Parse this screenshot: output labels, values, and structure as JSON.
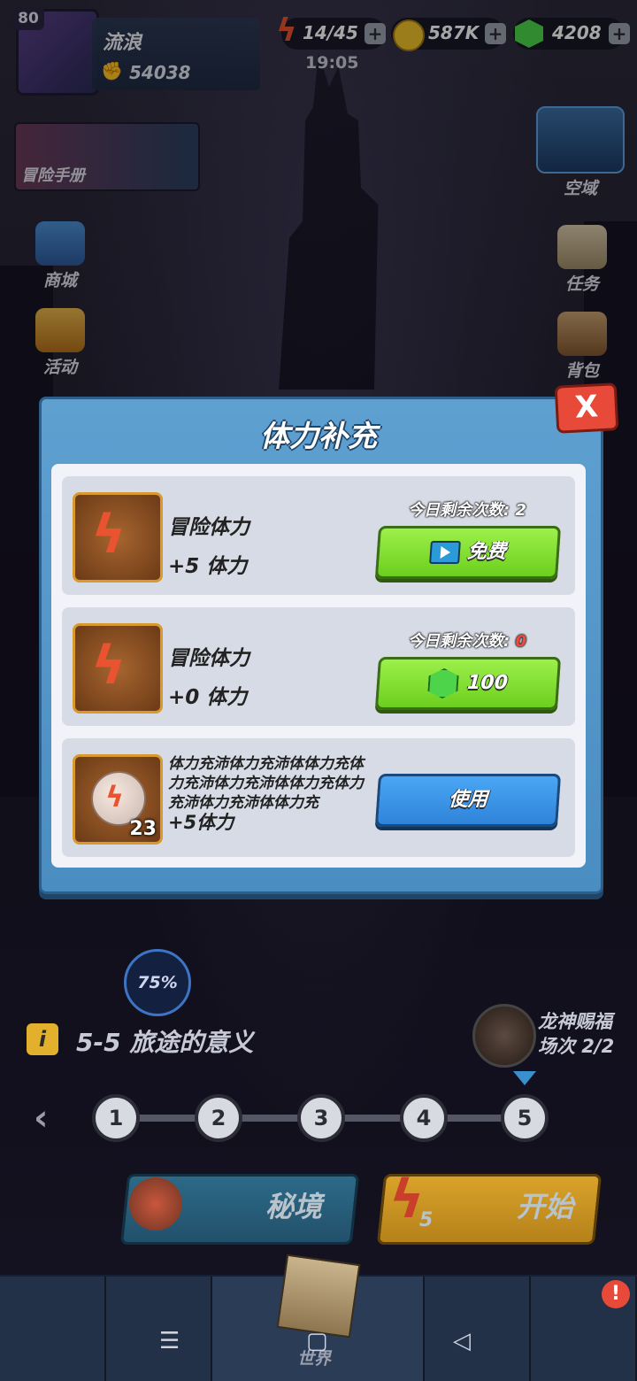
{
  "topbar": {
    "level": "80",
    "player_name": "流浪",
    "power": "54038",
    "energy": "14/45",
    "gold": "587K",
    "gems": "4208",
    "time": "19:05"
  },
  "side_menu": {
    "handbook": "冒险手册",
    "shop": "商城",
    "events": "活动",
    "sky_domain": "空域",
    "tasks": "任务",
    "backpack": "背包"
  },
  "dialog": {
    "title": "体力补充",
    "close_label": "X",
    "rows": [
      {
        "name": "冒险体力",
        "amount": "+5 体力",
        "remain_label": "今日剩余次数:",
        "remain_count": "2",
        "button": "免费"
      },
      {
        "name": "冒险体力",
        "amount": "+0 体力",
        "remain_label": "今日剩余次数:",
        "remain_count": "0",
        "button": "100"
      },
      {
        "desc": "体力充沛体力充沛体体力充体力充沛体力充沛体体力充体力充沛体力充沛体体力充",
        "amount": "+5体力",
        "count": "23",
        "button": "使用"
      }
    ]
  },
  "stage": {
    "progress": "75%",
    "info_icon": "i",
    "title": "5-5 旅途的意义",
    "dragon_blessing": "龙神赐福",
    "dragon_count": "场次 2/2",
    "nodes": [
      "1",
      "2",
      "3",
      "4",
      "5"
    ],
    "secret_realm": "秘境",
    "start": "开始",
    "start_cost": "5"
  },
  "bottom_nav": {
    "world": "世界"
  }
}
